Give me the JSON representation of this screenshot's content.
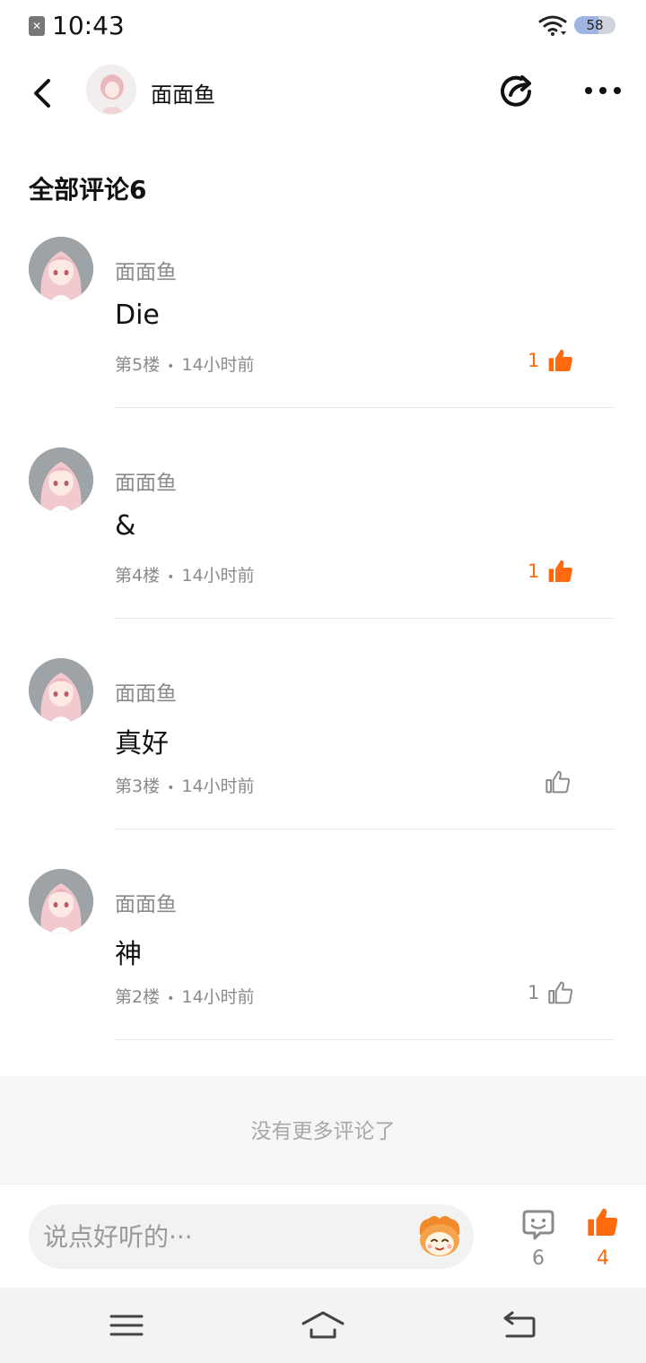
{
  "status": {
    "time": "10:43",
    "battery": "58",
    "battery_level": 0.58
  },
  "header": {
    "name": "面面鱼"
  },
  "section_title": "全部评论6",
  "colors": {
    "accent": "#ff6a0f",
    "gray": "#8a8a8a"
  },
  "comments": [
    {
      "name": "面面鱼",
      "text": "Die",
      "floor": "第5楼",
      "dot": "•",
      "time": "14小时前",
      "likes": "1",
      "liked": true
    },
    {
      "name": "面面鱼",
      "text": "&",
      "floor": "第4楼",
      "dot": "•",
      "time": "14小时前",
      "likes": "1",
      "liked": true
    },
    {
      "name": "面面鱼",
      "text": "真好",
      "floor": "第3楼",
      "dot": "•",
      "time": "14小时前",
      "likes": "",
      "liked": false
    },
    {
      "name": "面面鱼",
      "text": "神",
      "floor": "第2楼",
      "dot": "•",
      "time": "14小时前",
      "likes": "1",
      "liked": false
    }
  ],
  "no_more": "没有更多评论了",
  "input": {
    "placeholder": "说点好听的···"
  },
  "actions": {
    "comments": "6",
    "likes": "4"
  },
  "icons": {
    "back": "chevron-left-icon",
    "share": "share-icon",
    "more": "more-icon",
    "like": "thumbs-up-icon",
    "comment": "comment-icon",
    "emoji": "emoji-mascot-icon",
    "nav_menu": "menu-icon",
    "nav_home": "home-icon",
    "nav_back": "return-icon"
  }
}
